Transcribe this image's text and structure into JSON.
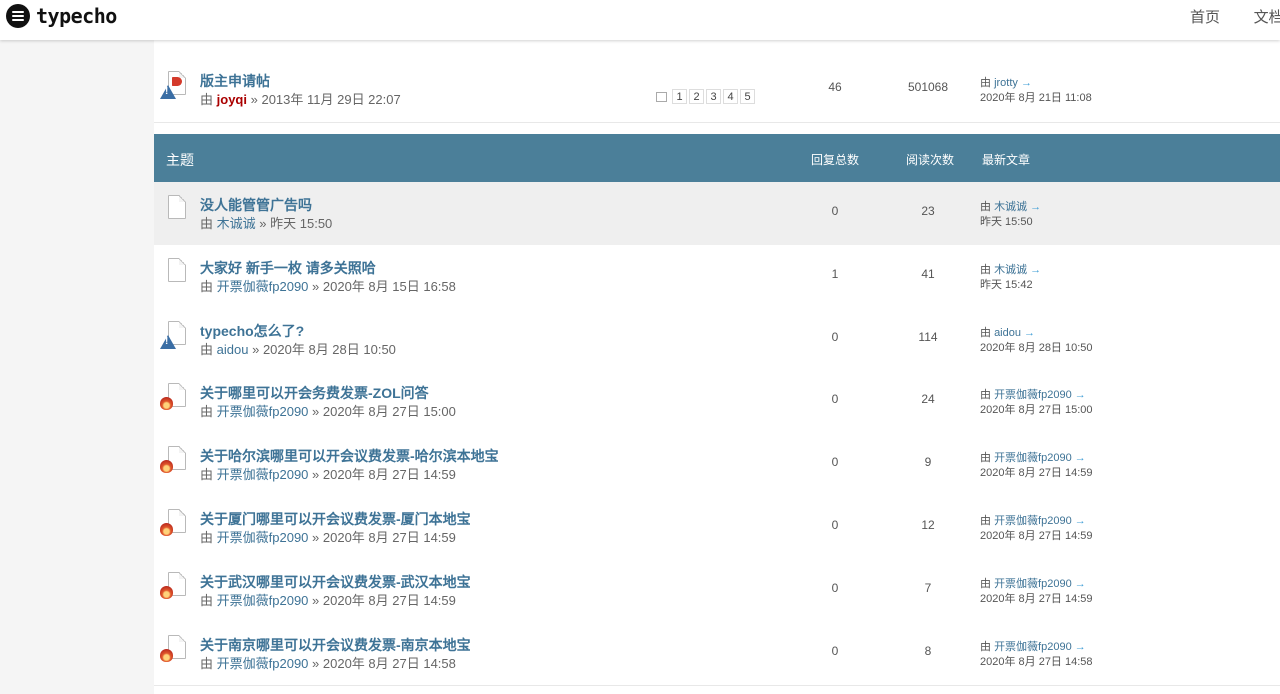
{
  "brand": {
    "name": "typecho"
  },
  "nav": [
    {
      "label": "首页"
    },
    {
      "label": "文档"
    }
  ],
  "announcements": [
    {
      "title": "版主申请帖",
      "author": "joyqi",
      "sep": "»",
      "date": "2013年 11月 29日 22:07",
      "pages": [
        "1",
        "2",
        "3",
        "4",
        "5"
      ],
      "replies": "46",
      "views": "501068",
      "last_by_prefix": "由",
      "last_author": "jrotty",
      "last_date": "2020年 8月 21日 11:08"
    }
  ],
  "table_header": {
    "topic": "主题",
    "replies": "回复总数",
    "views": "阅读次数",
    "last": "最新文章"
  },
  "by_prefix": "由",
  "sep": "»",
  "arrow": "→",
  "topics": [
    {
      "title": "没人能管管广告吗",
      "author": "木诚诚",
      "date": "昨天 15:50",
      "replies": "0",
      "views": "23",
      "last_author": "木诚诚",
      "last_date": "昨天 15:50",
      "badge": "none"
    },
    {
      "title": "大家好 新手一枚 请多关照哈",
      "author": "开票伽薇fp2090",
      "date": "2020年 8月 15日 16:58",
      "replies": "1",
      "views": "41",
      "last_author": "木诚诚",
      "last_date": "昨天 15:42",
      "badge": "none"
    },
    {
      "title": "typecho怎么了?",
      "author": "aidou",
      "date": "2020年 8月 28日 10:50",
      "replies": "0",
      "views": "114",
      "last_author": "aidou",
      "last_date": "2020年 8月 28日 10:50",
      "badge": "warn"
    },
    {
      "title": "关于哪里可以开会务费发票-ZOL问答",
      "author": "开票伽薇fp2090",
      "date": "2020年 8月 27日 15:00",
      "replies": "0",
      "views": "24",
      "last_author": "开票伽薇fp2090",
      "last_date": "2020年 8月 27日 15:00",
      "badge": "hot"
    },
    {
      "title": "关于哈尔滨哪里可以开会议费发票-哈尔滨本地宝",
      "author": "开票伽薇fp2090",
      "date": "2020年 8月 27日 14:59",
      "replies": "0",
      "views": "9",
      "last_author": "开票伽薇fp2090",
      "last_date": "2020年 8月 27日 14:59",
      "badge": "hot"
    },
    {
      "title": "关于厦门哪里可以开会议费发票-厦门本地宝",
      "author": "开票伽薇fp2090",
      "date": "2020年 8月 27日 14:59",
      "replies": "0",
      "views": "12",
      "last_author": "开票伽薇fp2090",
      "last_date": "2020年 8月 27日 14:59",
      "badge": "hot"
    },
    {
      "title": "关于武汉哪里可以开会议费发票-武汉本地宝",
      "author": "开票伽薇fp2090",
      "date": "2020年 8月 27日 14:59",
      "replies": "0",
      "views": "7",
      "last_author": "开票伽薇fp2090",
      "last_date": "2020年 8月 27日 14:59",
      "badge": "hot"
    },
    {
      "title": "关于南京哪里可以开会议费发票-南京本地宝",
      "author": "开票伽薇fp2090",
      "date": "2020年 8月 27日 14:58",
      "replies": "0",
      "views": "8",
      "last_author": "开票伽薇fp2090",
      "last_date": "2020年 8月 27日 14:58",
      "badge": "hot"
    }
  ]
}
